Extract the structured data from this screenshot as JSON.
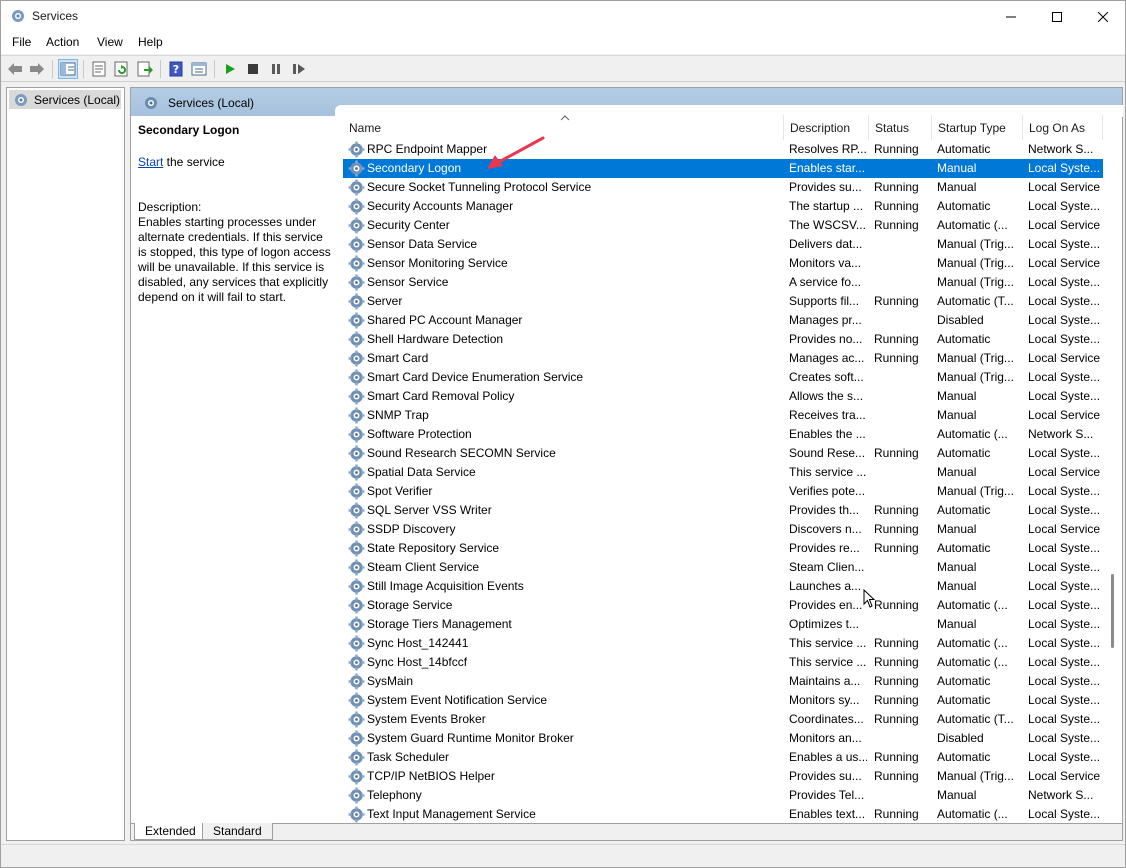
{
  "window": {
    "title": "Services",
    "minimize_icon": "minimize-icon",
    "maximize_icon": "maximize-icon",
    "close_icon": "close-icon"
  },
  "menu": [
    "File",
    "Action",
    "View",
    "Help"
  ],
  "toolbar": {
    "buttons": [
      "back-icon",
      "forward-icon",
      "show-hide-console-tree-icon",
      "properties-icon",
      "refresh-icon",
      "export-list-icon",
      "help-icon",
      "show-action-pane-icon",
      "start-service-icon",
      "stop-service-icon",
      "pause-service-icon",
      "resume-service-icon"
    ]
  },
  "tree": {
    "root_label": "Services (Local)"
  },
  "panel": {
    "header": "Services (Local)",
    "info": {
      "title": "Secondary Logon",
      "action_link": "Start",
      "action_suffix": " the service",
      "description_label": "Description:",
      "description": "Enables starting processes under alternate credentials. If this service is stopped, this type of logon access will be unavailable. If this service is disabled, any services that explicitly depend on it will fail to start."
    },
    "columns": [
      "Name",
      "Description",
      "Status",
      "Startup Type",
      "Log On As"
    ],
    "rows": [
      {
        "name": "RPC Endpoint Mapper",
        "desc": "Resolves RP...",
        "status": "Running",
        "startup": "Automatic",
        "logon": "Network S..."
      },
      {
        "name": "Secondary Logon",
        "desc": "Enables star...",
        "status": "",
        "startup": "Manual",
        "logon": "Local Syste...",
        "selected": true
      },
      {
        "name": "Secure Socket Tunneling Protocol Service",
        "desc": "Provides su...",
        "status": "Running",
        "startup": "Manual",
        "logon": "Local Service"
      },
      {
        "name": "Security Accounts Manager",
        "desc": "The startup ...",
        "status": "Running",
        "startup": "Automatic",
        "logon": "Local Syste..."
      },
      {
        "name": "Security Center",
        "desc": "The WSCSV...",
        "status": "Running",
        "startup": "Automatic (...",
        "logon": "Local Service"
      },
      {
        "name": "Sensor Data Service",
        "desc": "Delivers dat...",
        "status": "",
        "startup": "Manual (Trig...",
        "logon": "Local Syste..."
      },
      {
        "name": "Sensor Monitoring Service",
        "desc": "Monitors va...",
        "status": "",
        "startup": "Manual (Trig...",
        "logon": "Local Service"
      },
      {
        "name": "Sensor Service",
        "desc": "A service fo...",
        "status": "",
        "startup": "Manual (Trig...",
        "logon": "Local Syste..."
      },
      {
        "name": "Server",
        "desc": "Supports fil...",
        "status": "Running",
        "startup": "Automatic (T...",
        "logon": "Local Syste..."
      },
      {
        "name": "Shared PC Account Manager",
        "desc": "Manages pr...",
        "status": "",
        "startup": "Disabled",
        "logon": "Local Syste..."
      },
      {
        "name": "Shell Hardware Detection",
        "desc": "Provides no...",
        "status": "Running",
        "startup": "Automatic",
        "logon": "Local Syste..."
      },
      {
        "name": "Smart Card",
        "desc": "Manages ac...",
        "status": "Running",
        "startup": "Manual (Trig...",
        "logon": "Local Service"
      },
      {
        "name": "Smart Card Device Enumeration Service",
        "desc": "Creates soft...",
        "status": "",
        "startup": "Manual (Trig...",
        "logon": "Local Syste..."
      },
      {
        "name": "Smart Card Removal Policy",
        "desc": "Allows the s...",
        "status": "",
        "startup": "Manual",
        "logon": "Local Syste..."
      },
      {
        "name": "SNMP Trap",
        "desc": "Receives tra...",
        "status": "",
        "startup": "Manual",
        "logon": "Local Service"
      },
      {
        "name": "Software Protection",
        "desc": "Enables the ...",
        "status": "",
        "startup": "Automatic (...",
        "logon": "Network S..."
      },
      {
        "name": "Sound Research SECOMN Service",
        "desc": "Sound Rese...",
        "status": "Running",
        "startup": "Automatic",
        "logon": "Local Syste..."
      },
      {
        "name": "Spatial Data Service",
        "desc": "This service ...",
        "status": "",
        "startup": "Manual",
        "logon": "Local Service"
      },
      {
        "name": "Spot Verifier",
        "desc": "Verifies pote...",
        "status": "",
        "startup": "Manual (Trig...",
        "logon": "Local Syste..."
      },
      {
        "name": "SQL Server VSS Writer",
        "desc": "Provides th...",
        "status": "Running",
        "startup": "Automatic",
        "logon": "Local Syste..."
      },
      {
        "name": "SSDP Discovery",
        "desc": "Discovers n...",
        "status": "Running",
        "startup": "Manual",
        "logon": "Local Service"
      },
      {
        "name": "State Repository Service",
        "desc": "Provides re...",
        "status": "Running",
        "startup": "Automatic",
        "logon": "Local Syste..."
      },
      {
        "name": "Steam Client Service",
        "desc": "Steam Clien...",
        "status": "",
        "startup": "Manual",
        "logon": "Local Syste..."
      },
      {
        "name": "Still Image Acquisition Events",
        "desc": "Launches a...",
        "status": "",
        "startup": "Manual",
        "logon": "Local Syste..."
      },
      {
        "name": "Storage Service",
        "desc": "Provides en...",
        "status": "Running",
        "startup": "Automatic (...",
        "logon": "Local Syste..."
      },
      {
        "name": "Storage Tiers Management",
        "desc": "Optimizes t...",
        "status": "",
        "startup": "Manual",
        "logon": "Local Syste..."
      },
      {
        "name": "Sync Host_142441",
        "desc": "This service ...",
        "status": "Running",
        "startup": "Automatic (...",
        "logon": "Local Syste..."
      },
      {
        "name": "Sync Host_14bfccf",
        "desc": "This service ...",
        "status": "Running",
        "startup": "Automatic (...",
        "logon": "Local Syste..."
      },
      {
        "name": "SysMain",
        "desc": "Maintains a...",
        "status": "Running",
        "startup": "Automatic",
        "logon": "Local Syste..."
      },
      {
        "name": "System Event Notification Service",
        "desc": "Monitors sy...",
        "status": "Running",
        "startup": "Automatic",
        "logon": "Local Syste..."
      },
      {
        "name": "System Events Broker",
        "desc": "Coordinates...",
        "status": "Running",
        "startup": "Automatic (T...",
        "logon": "Local Syste..."
      },
      {
        "name": "System Guard Runtime Monitor Broker",
        "desc": "Monitors an...",
        "status": "",
        "startup": "Disabled",
        "logon": "Local Syste..."
      },
      {
        "name": "Task Scheduler",
        "desc": "Enables a us...",
        "status": "Running",
        "startup": "Automatic",
        "logon": "Local Syste..."
      },
      {
        "name": "TCP/IP NetBIOS Helper",
        "desc": "Provides su...",
        "status": "Running",
        "startup": "Manual (Trig...",
        "logon": "Local Service"
      },
      {
        "name": "Telephony",
        "desc": "Provides Tel...",
        "status": "",
        "startup": "Manual",
        "logon": "Network S..."
      },
      {
        "name": "Text Input Management Service",
        "desc": "Enables text...",
        "status": "Running",
        "startup": "Automatic (...",
        "logon": "Local Syste..."
      }
    ],
    "tabs": [
      "Extended",
      "Standard"
    ]
  },
  "colors": {
    "selection": "#0078d7",
    "header_blue": "#a6c1dd",
    "annotation_arrow": "#e8374f",
    "link": "#0645ad"
  }
}
